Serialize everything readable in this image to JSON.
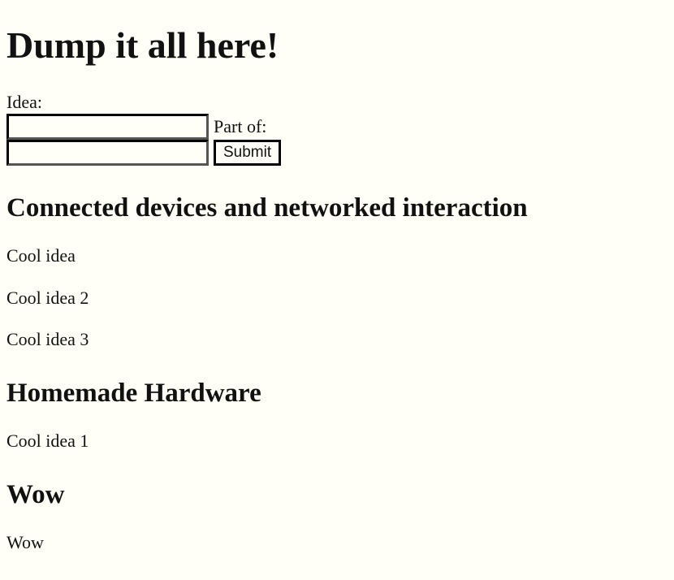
{
  "page": {
    "title": "Dump it all here!"
  },
  "form": {
    "idea_label": "Idea:",
    "idea_value": "",
    "part_of_label": "Part of:",
    "part_of_value": "",
    "submit_label": "Submit"
  },
  "sections": [
    {
      "heading": "Connected devices and networked interaction",
      "ideas": [
        "Cool idea",
        "Cool idea 2",
        "Cool idea 3"
      ]
    },
    {
      "heading": "Homemade Hardware",
      "ideas": [
        "Cool idea 1"
      ]
    },
    {
      "heading": "Wow",
      "ideas": [
        "Wow"
      ]
    }
  ],
  "colors": {
    "background": "#fffff7",
    "text": "#111111"
  }
}
